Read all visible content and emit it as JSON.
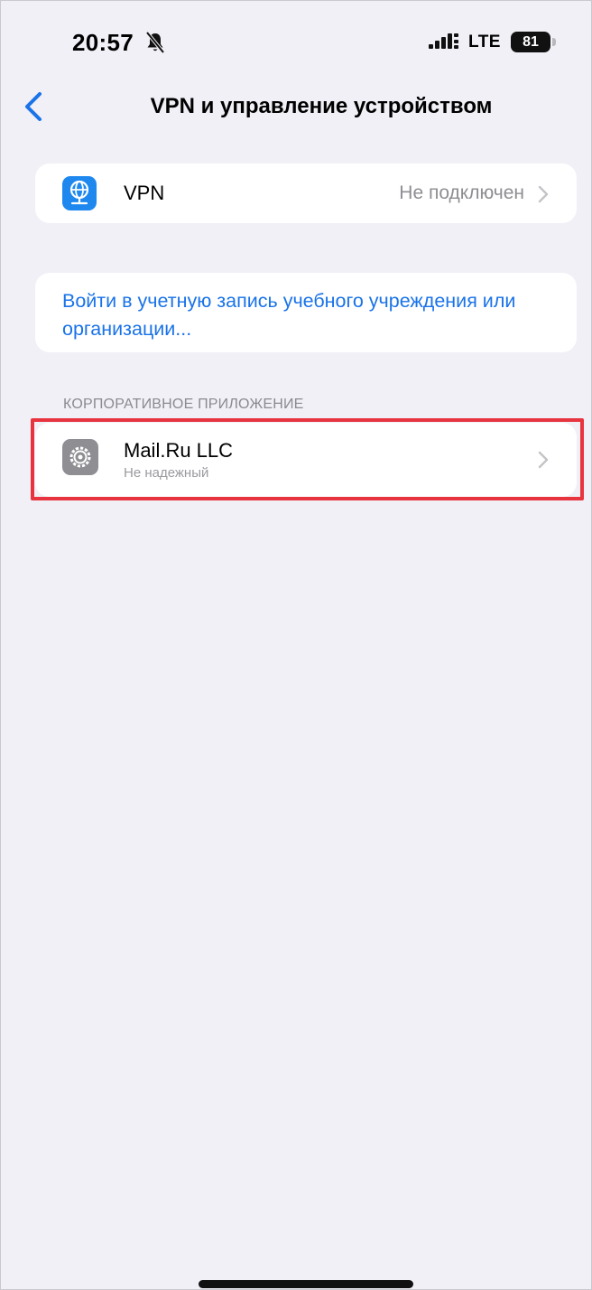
{
  "status_bar": {
    "time": "20:57",
    "network": "LTE",
    "battery": "81",
    "icons": [
      "bell-slash-icon",
      "signal-icon",
      "battery-icon"
    ]
  },
  "nav": {
    "title": "VPN и управление устройством",
    "back_icon": "chevron-left-icon"
  },
  "vpn_row": {
    "label": "VPN",
    "status": "Не подключен",
    "icon": "vpn-globe-icon"
  },
  "signin": {
    "link_text": "Войти в учетную запись учебного учреждения или организации..."
  },
  "enterprise": {
    "header": "КОРПОРАТИВНОЕ ПРИЛОЖЕНИЕ",
    "app_name": "Mail.Ru LLC",
    "app_status": "Не надежный",
    "icon": "gear-icon"
  },
  "colors": {
    "background": "#f1f0f6",
    "accent": "#1a73e8",
    "highlight": "#e8343f",
    "secondary_text": "#8e8e93"
  }
}
